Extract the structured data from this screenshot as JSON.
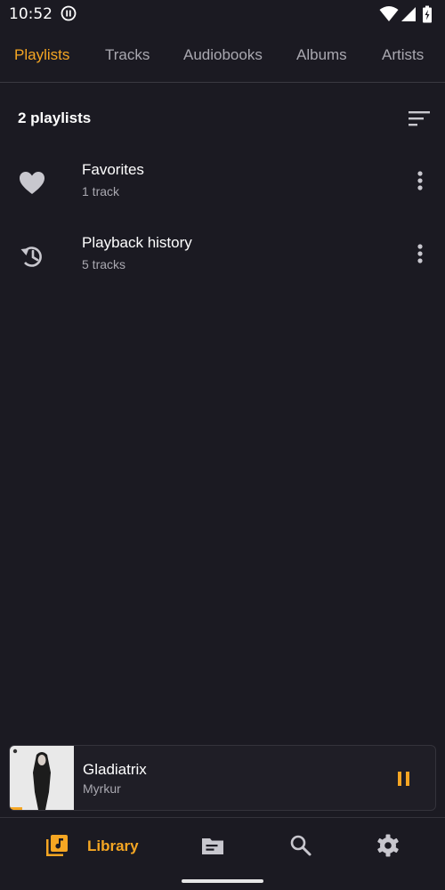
{
  "status_bar": {
    "time": "10:52",
    "icons": [
      "media-playing-icon",
      "wifi-icon",
      "signal-icon",
      "battery-icon"
    ]
  },
  "tabs": [
    {
      "label": "Playlists",
      "active": true
    },
    {
      "label": "Tracks",
      "active": false
    },
    {
      "label": "Audiobooks",
      "active": false
    },
    {
      "label": "Albums",
      "active": false
    },
    {
      "label": "Artists",
      "active": false
    }
  ],
  "list": {
    "count_label": "2 playlists",
    "sort_icon": "sort-icon",
    "items": [
      {
        "title": "Favorites",
        "subtitle": "1 track",
        "icon": "heart-icon"
      },
      {
        "title": "Playback history",
        "subtitle": "5 tracks",
        "icon": "history-icon"
      }
    ]
  },
  "mini_player": {
    "title": "Gladiatrix",
    "artist": "Myrkur",
    "state_icon": "pause-icon",
    "progress": 0.03
  },
  "bottom_nav": {
    "items": [
      {
        "label": "Library",
        "icon": "library-music-icon",
        "active": true
      },
      {
        "label": "",
        "icon": "folder-icon",
        "active": false
      },
      {
        "label": "",
        "icon": "search-icon",
        "active": false
      },
      {
        "label": "",
        "icon": "gear-icon",
        "active": false
      }
    ]
  },
  "colors": {
    "background": "#1b1a22",
    "accent": "#f5a623",
    "text_primary": "#ffffff",
    "text_secondary": "#a9a8b0",
    "icon": "#c8c7ce"
  }
}
